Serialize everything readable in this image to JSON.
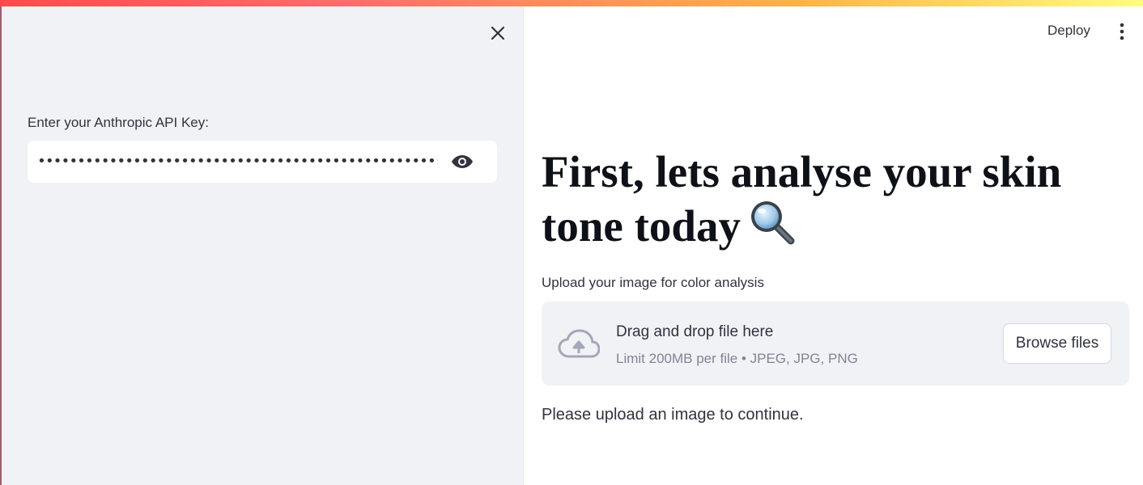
{
  "sidebar": {
    "api_key_label": "Enter your Anthropic API Key:",
    "api_key_value": "••••••••••••••••••••••••••••••••••••••••••••••••••••••••••••••••••••••••••••••••••",
    "close_icon": "close-icon",
    "visibility_icon": "eye-icon"
  },
  "header": {
    "deploy_label": "Deploy",
    "menu_icon": "more-vertical-icon"
  },
  "main": {
    "title": "First, lets analyse your skin tone today",
    "title_icon": "magnifying-glass-icon",
    "upload": {
      "label": "Upload your image for color analysis",
      "drop_primary": "Drag and drop file here",
      "drop_secondary": "Limit 200MB per file • JPEG, JPG, PNG",
      "browse_label": "Browse files",
      "icon": "cloud-upload-icon"
    },
    "status": "Please upload an image to continue."
  },
  "colors": {
    "sidebar_bg": "#f0f2f6",
    "text": "#31333f",
    "muted_text": "#808495",
    "title_text": "#0e1117",
    "accent_gradient_start": "#ff4b4b",
    "accent_gradient_end": "#fffd80"
  }
}
